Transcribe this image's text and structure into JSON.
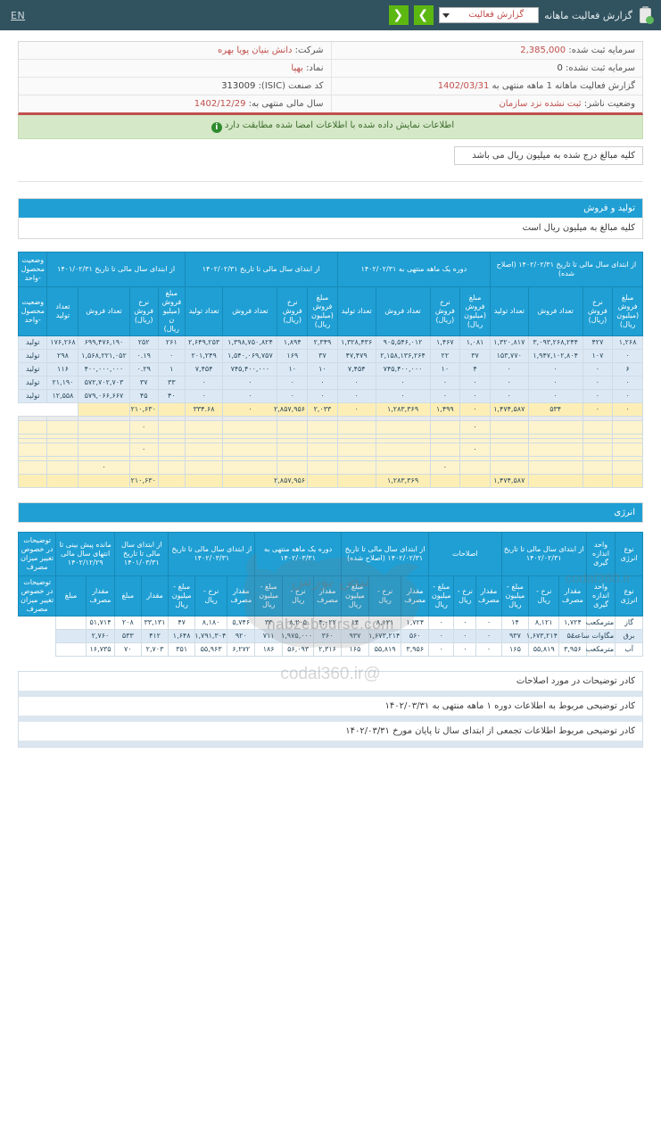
{
  "topbar": {
    "title": "گزارش فعالیت ماهانه",
    "report_select_value": "گزارش فعالیت",
    "prev_label": "❮",
    "next_label": "❯",
    "lang_label": "EN",
    "icons": {
      "clipboard": "clipboard-check-icon",
      "caret": "chevron-down-icon"
    }
  },
  "info": {
    "company_label": "شرکت:",
    "company_value": "دانش بنیان پویا بهره",
    "registered_capital_label": "سرمایه ثبت شده:",
    "registered_capital_value": "2,385,000",
    "symbol_label": "نماد:",
    "symbol_value": "بهپا",
    "unregistered_capital_label": "سرمایه ثبت نشده:",
    "unregistered_capital_value": "0",
    "isic_label": "کد صنعت (ISIC):",
    "isic_value": "313009",
    "period_label": "گزارش فعالیت ماهانه  1  ماهه منتهی به",
    "period_value": "1402/03/31",
    "fiscal_year_label": "سال مالی منتهی به:",
    "fiscal_year_value": "1402/12/29",
    "publisher_status_label": "وضعیت ناشر:",
    "publisher_status_value": "ثبت نشده نزد سازمان",
    "verified_message": "اطلاعات نمایش داده شده با اطلاعات امضا شده مطابقت دارد",
    "amount_note": "کلیه مبالغ درج شده به میلیون ریال می باشد"
  },
  "production_section": {
    "heading": "تولید و فروش",
    "subheading": "کلیه مبالغ به میلیون ریال است"
  },
  "production_table": {
    "group_headers": [
      {
        "label": "از ابتدای سال مالی تا تاریخ ۱۴۰۲/۰۲/۳۱ (اصلاح شده)",
        "span": 4
      },
      {
        "label": "دوره یک ماهه منتهی به ۱۴۰۲/۰۲/۳۱",
        "span": 4
      },
      {
        "label": "از ابتدای سال مالی تا تاریخ ۱۴۰۲/۰۲/۳۱",
        "span": 4
      },
      {
        "label": "از ابتدای سال مالی تا تاریخ ۱۴۰۱/۰۲/۳۱",
        "span": 4
      },
      {
        "label": "وضعیت محصول-واحد",
        "span": 1
      }
    ],
    "columns": [
      "مبلغ فروش (میلیون ریال)",
      "نرخ فروش (ریال)",
      "تعداد فروش",
      "تعداد تولید",
      "مبلغ فروش (میلیون ریال)",
      "نرخ فروش (ریال)",
      "تعداد فروش",
      "تعداد تولید",
      "مبلغ فروش (میلیون ریال)",
      "نرخ فروش (ریال)",
      "تعداد فروش",
      "تعداد تولید",
      "مبلغ فروش (میلیون ریال)",
      "نرخ فروش (ریال)",
      "تعداد فروش",
      "تعداد تولید",
      "وضعیت محصول-واحد"
    ],
    "rows": [
      {
        "style": "r-blue",
        "cells": [
          "۱,۲۶۸",
          "۴۲۷",
          "۳,۰۹۳,۲۶۸,۲۴۴",
          "۱,۳۲۰,۸۱۷",
          "۱,۰۸۱",
          "۱,۴۶۷",
          "۹۰۵,۵۴۶,۰۱۲",
          "۱,۳۲۸,۴۳۶",
          "۲,۳۴۹",
          "۱,۸۹۴",
          "۱,۳۹۸,۷۵۰,۸۲۴",
          "۲,۶۴۹,۲۵۳",
          "۲۶۱",
          "۲۵۲",
          "۶۹۹,۴۷۶,۱۹۰",
          "۱۷۶,۲۶۸",
          "تولید"
        ]
      },
      {
        "style": "r-blue",
        "cells": [
          "۰",
          "۱۰۷",
          "۱,۹۴۷,۱۰۲,۸۰۴",
          "۱۵۳,۷۷۰",
          "۳۷",
          "۲۲",
          "۲,۱۵۸,۱۳۶,۲۶۴",
          "۴۷,۴۷۹",
          "۳۷",
          "۱۶۹",
          "۱,۵۴۰,۰۶۹,۷۵۷",
          "۲۰۱,۲۴۹",
          "۰",
          "۰.۱۹",
          "۱,۵۶۸,۲۲۱,۰۵۲",
          "۲۹۸",
          "تولید"
        ]
      },
      {
        "style": "r-blue",
        "cells": [
          "۶",
          "۰",
          "۰",
          "۰",
          "۴",
          "۱۰",
          "۷۴۵,۴۰۰,۰۰۰",
          "۷,۴۵۴",
          "۱۰",
          "۱۰",
          "۷۴۵,۴۰۰,۰۰۰",
          "۷,۴۵۴",
          "۱",
          "۰.۲۹",
          "۴۰۰,۰۰۰,۰۰۰",
          "۱۱۶",
          "تولید"
        ]
      },
      {
        "style": "r-blue",
        "cells": [
          "۰",
          "۰",
          "۰",
          "۰",
          "۰",
          "۰",
          "۰",
          "۰",
          "۰",
          "۰",
          "۰",
          "۰",
          "۳۳",
          "۳۷",
          "۵۷۲,۷۰۲,۷۰۳",
          "۲۱,۱۹۰",
          "تولید"
        ]
      },
      {
        "style": "r-blue",
        "cells": [
          "۰",
          "۰",
          "۰",
          "۰",
          "۰",
          "۰",
          "۰",
          "۰",
          "۰",
          "۰",
          "۰",
          "۰",
          "۴۰",
          "۴۵",
          "۵۷۹,۰۶۶,۶۶۷",
          "۱۲,۵۵۸",
          "تولید"
        ]
      },
      {
        "style": "r-yellow",
        "cells": [
          "۰",
          "۰",
          "۵۳۴",
          "۱,۴۷۴,۵۸۷",
          "۰",
          "۱,۴۹۹",
          "۱,۲۸۳,۳۶۹",
          "۰",
          "۲,۰۳۳",
          "۲,۸۵۷,۹۵۶",
          "۰",
          "۳۳۴.۶۸",
          "",
          "۲۱۰,۶۳۰",
          ""
        ]
      },
      {
        "style": "r-gray",
        "cells": [
          "",
          "",
          "",
          "",
          "",
          "",
          "",
          "",
          "",
          "",
          "",
          "",
          "",
          "",
          "",
          "",
          ""
        ]
      },
      {
        "style": "r-yellow-lite",
        "cells": [
          "",
          "",
          "",
          "",
          "۰",
          "",
          "",
          "",
          "",
          "",
          "",
          "",
          "",
          "۰",
          "",
          "",
          ""
        ]
      },
      {
        "style": "r-yellow-lite",
        "cells": [
          "",
          "",
          "",
          "",
          "",
          "",
          "",
          "",
          "",
          "",
          "",
          "",
          "",
          "",
          "",
          "",
          ""
        ]
      },
      {
        "style": "r-yellow-lite",
        "cells": [
          "",
          "",
          "",
          "",
          "",
          "",
          "",
          "",
          "",
          "",
          "",
          "",
          "",
          "",
          "",
          "",
          ""
        ]
      },
      {
        "style": "r-yellow-lite",
        "cells": [
          "",
          "",
          "",
          "",
          "۰",
          "",
          "",
          "",
          "",
          "",
          "",
          "",
          "",
          "۰",
          "",
          "",
          ""
        ]
      },
      {
        "style": "r-yellow-lite",
        "cells": [
          "",
          "",
          "",
          "",
          "",
          "",
          "",
          "",
          "",
          "",
          "",
          "",
          "",
          "",
          "",
          "",
          ""
        ]
      },
      {
        "style": "r-yellow-lite",
        "cells": [
          "",
          "",
          "",
          "",
          "",
          "۰",
          "",
          "",
          "",
          "",
          "",
          "",
          "",
          "",
          "۰",
          "",
          ""
        ]
      },
      {
        "style": "r-yellow",
        "cells": [
          "",
          "",
          "",
          "۱,۴۷۴,۵۸۷",
          "",
          "",
          "۱,۲۸۳,۳۶۹",
          "",
          "",
          "۲,۸۵۷,۹۵۶",
          "",
          "",
          "",
          "۲۱۰,۶۳۰",
          "",
          "",
          ""
        ]
      }
    ]
  },
  "energy_section": {
    "heading": "انرژی"
  },
  "energy_table": {
    "group_headers": [
      {
        "label": "نوع انرژی",
        "span": 1
      },
      {
        "label": "واحد اندازه گیری",
        "span": 1
      },
      {
        "label": "از ابتدای سال مالی تا تاریخ ۱۴۰۲/۰۲/۳۱",
        "span": 3
      },
      {
        "label": "اصلاحات",
        "span": 3
      },
      {
        "label": "از ابتدای سال مالی تا تاریخ ۱۴۰۲/۰۲/۳۱ (اصلاح شده)",
        "span": 3
      },
      {
        "label": "دوره یک ماهه منتهی به ۱۴۰۲/۰۳/۳۱",
        "span": 3
      },
      {
        "label": "از ابتدای سال مالی تا تاریخ ۱۴۰۲/۰۳/۳۱",
        "span": 3
      },
      {
        "label": "از ابتدای سال مالی تا تاریخ ۱۴۰۱/۰۳/۳۱",
        "span": 2
      },
      {
        "label": "مانده پیش بینی تا انتهای سال مالی ۱۴۰۲/۱۲/۲۹",
        "span": 2
      },
      {
        "label": "توضیحات در خصوص تغییر میزان مصرف",
        "span": 1
      }
    ],
    "columns": [
      "نوع انرژی",
      "واحد اندازه گیری",
      "مقدار مصرف",
      "نرخ - ریال",
      "مبلغ - میلیون ریال",
      "مقدار مصرف",
      "نرخ - ریال",
      "مبلغ - میلیون ریال",
      "مقدار مصرف",
      "نرخ - ریال",
      "مبلغ - میلیون ریال",
      "مقدار مصرف",
      "نرخ - ریال",
      "مبلغ - میلیون ریال",
      "مقدار مصرف",
      "نرخ - ریال",
      "مبلغ - میلیون ریال",
      "مقدار",
      "مبلغ",
      "مقدار مصرف",
      "مبلغ",
      "توضیحات در خصوص تغییر میزان مصرف"
    ],
    "rows": [
      {
        "style": "r-white",
        "cells": [
          "گاز",
          "مترمکعب",
          "۱,۷۲۴",
          "۸,۱۲۱",
          "۱۴",
          "۰",
          "۰",
          "۰",
          "۱,۷۲۴",
          "۸,۱۲۱",
          "۱۴",
          "۴,۰۲۲",
          "۸,۲۰۵",
          "۳۳",
          "۵,۷۴۶",
          "۸,۱۸۰",
          "۴۷",
          "۳۳,۱۳۱",
          "۲۰۸",
          "۵۱,۷۱۴",
          ""
        ]
      },
      {
        "style": "r-blue",
        "cells": [
          "برق",
          "مگاوات ساعت",
          "۵۶۰",
          "۱,۶۷۳,۲۱۴",
          "۹۳۷",
          "۰",
          "۰",
          "۰",
          "۵۶۰",
          "۱,۶۷۳,۲۱۴",
          "۹۳۷",
          "۳۶۰",
          "۱,۹۷۵,۰۰۰",
          "۷۱۱",
          "۹۲۰",
          "۱,۷۹۱,۳۰۴",
          "۱,۶۴۸",
          "۴۱۲",
          "۵۳۳",
          "۲,۷۶۰",
          ""
        ]
      },
      {
        "style": "r-white",
        "cells": [
          "آب",
          "مترمکعب",
          "۳,۹۵۶",
          "۵۵,۸۱۹",
          "۱۶۵",
          "۰",
          "۰",
          "۰",
          "۳,۹۵۶",
          "۵۵,۸۱۹",
          "۱۶۵",
          "۲,۳۱۶",
          "۵۶,۰۹۳",
          "۱۸۶",
          "۶,۲۷۲",
          "۵۵,۹۶۳",
          "۳۵۱",
          "۲,۷۰۳",
          "۷۰",
          "۱۶,۷۳۵",
          ""
        ]
      }
    ]
  },
  "notes": {
    "items": [
      "کادر توضیحات در مورد اصلاحات",
      "کادر توضیحی مربوط به اطلاعات دوره ۱ ماهه منتهی به ۱۴۰۲/۰۳/۳۱",
      "کادر توضیحی مربوط اطلاعات تجمعی از ابتدای سال تا پایان مورخ ۱۴۰۲/۰۳/۳۱"
    ]
  },
  "watermarks": {
    "site": "nabzebourse.com",
    "site_fa": "نبض بورس",
    "handle": "@codal360.ir",
    "corner": "codal360.ir"
  },
  "colors": {
    "topbar": "#31525f",
    "accent_blue": "#1f9fd4",
    "green": "#5cb811",
    "red_accent": "#c0504d",
    "row_blue": "#dce9f5",
    "row_yellow": "#fdeeb5"
  }
}
